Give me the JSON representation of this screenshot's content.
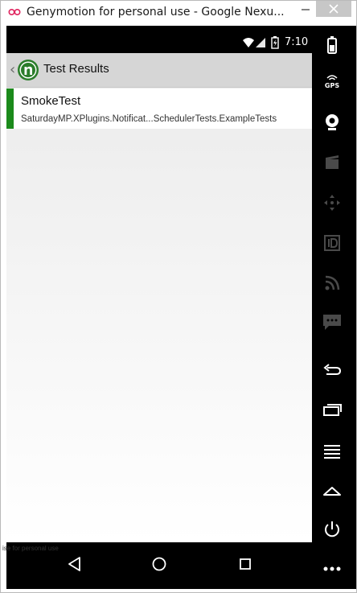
{
  "window": {
    "title": "Genymotion for personal use - Google Nexu..."
  },
  "status_bar": {
    "time": "7:10"
  },
  "action_bar": {
    "title": "Test Results"
  },
  "results": [
    {
      "name": "SmokeTest",
      "path": "SaturdayMP.XPlugins.Notificat...SchedulerTests.ExampleTests",
      "status_color": "#1b8a1b"
    }
  ],
  "watermark": "ise for personal use",
  "toolbar": {
    "gps_label": "GPS",
    "icons": [
      "battery-icon",
      "gps-icon",
      "webcam-icon",
      "video-icon",
      "dpad-icon",
      "id-icon",
      "rss-icon",
      "sms-icon",
      "back-icon",
      "recent-apps-icon",
      "menu-icon",
      "home-icon",
      "power-icon",
      "more-icon"
    ]
  },
  "nav": {
    "icons": [
      "back-triangle-icon",
      "home-circle-icon",
      "recents-square-icon"
    ]
  }
}
